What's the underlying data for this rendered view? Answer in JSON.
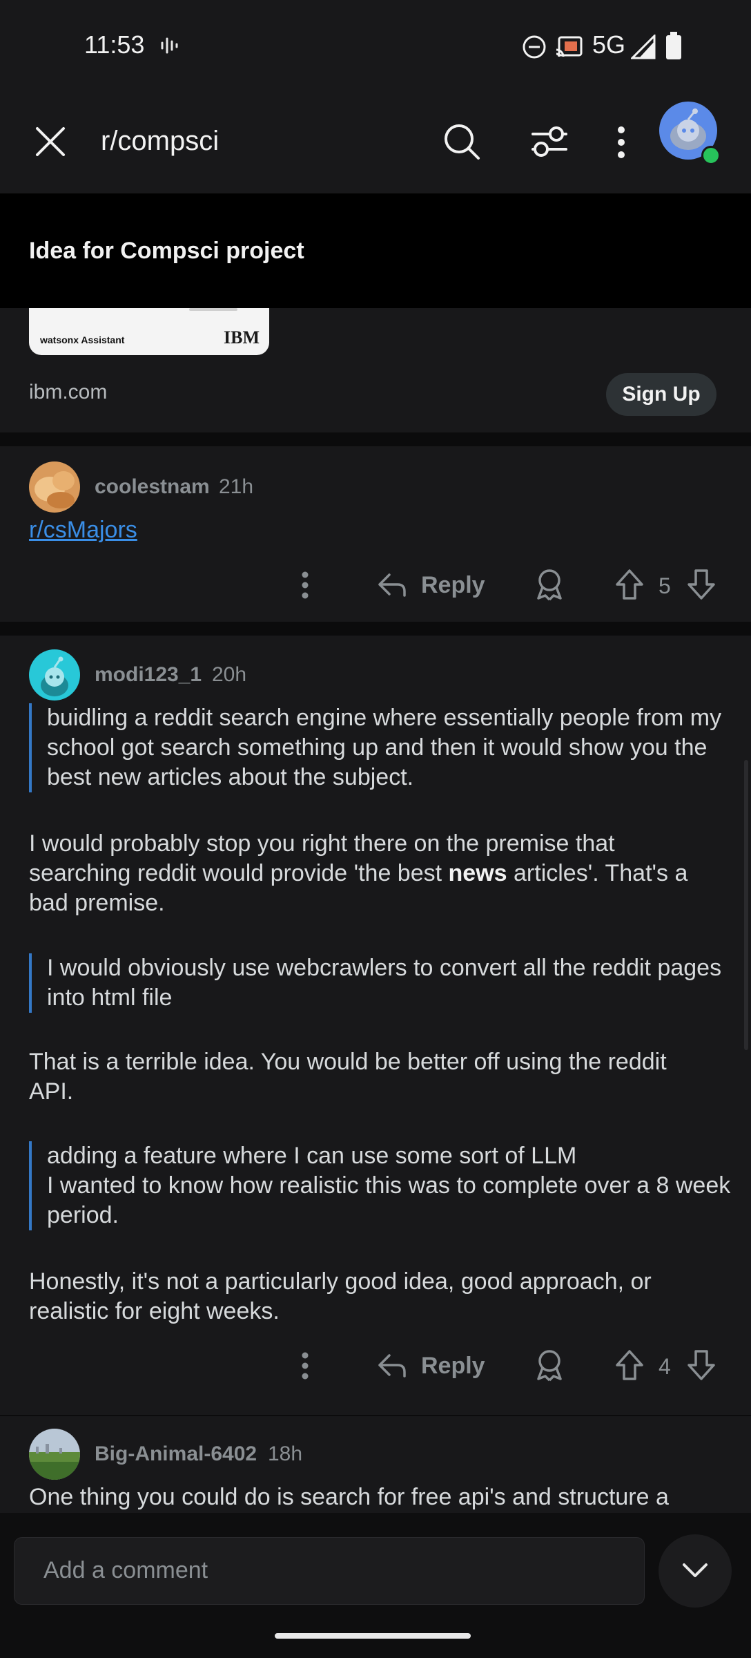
{
  "status": {
    "time": "11:53",
    "network": "5G"
  },
  "appbar": {
    "title": "r/compsci"
  },
  "post": {
    "title": "Idea for Compsci project"
  },
  "ad": {
    "brand_caption": "watsonx Assistant",
    "brand_logo": "IBM",
    "domain": "ibm.com",
    "cta": "Sign Up"
  },
  "comments": [
    {
      "user": "coolestnam",
      "time": "21h",
      "link": "r/csMajors",
      "reply": "Reply",
      "votes": "5"
    },
    {
      "user": "modi123_1",
      "time": "20h",
      "q1": "buidling a reddit search engine where essentially people from my school got search something up and then it would show you the best new articles about the subject.",
      "p1_a": "I would probably stop you right there on the premise that searching reddit would provide 'the best ",
      "p1_b": "news",
      "p1_c": " articles'. That's a bad premise.",
      "q2": "I would obviously use webcrawlers to convert all the reddit pages into html file",
      "p2": "That is a terrible idea.  You would be better off using the reddit API.",
      "q3_l1": "adding a feature where I can use some sort of LLM",
      "q3_l2": "I wanted to know how realistic this was to complete over a 8 week period.",
      "p3": "Honestly, it's not a particularly good idea, good approach, or realistic for eight weeks.",
      "reply": "Reply",
      "votes": "4"
    },
    {
      "user": "Big-Animal-6402",
      "time": "18h",
      "text": "One thing you could do is search for free api's and structure a project around one that interests you."
    }
  ],
  "composer": {
    "placeholder": "Add a comment"
  },
  "colors": {
    "accent": "#3478c6",
    "link": "#3a8ee6",
    "online": "#27c35b",
    "background": "#18181a"
  }
}
